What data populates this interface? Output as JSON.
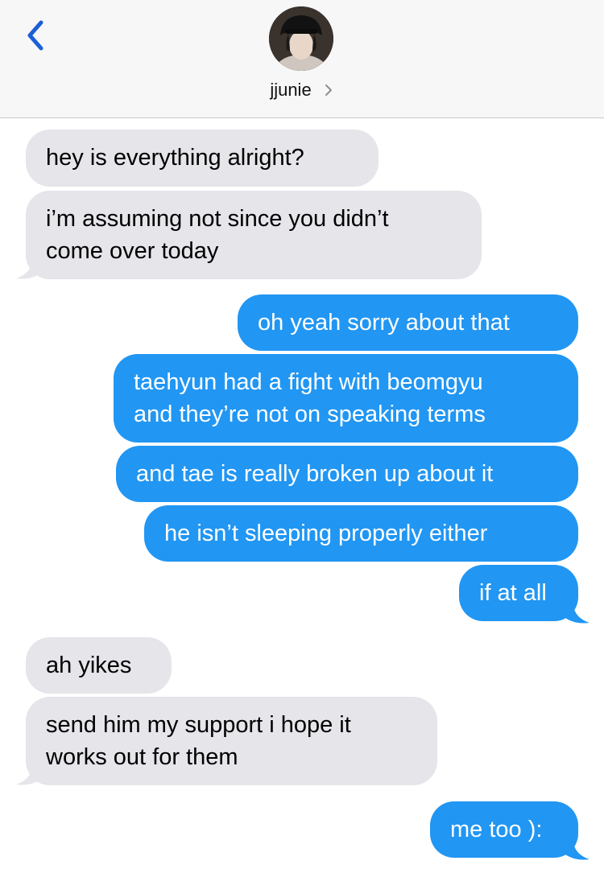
{
  "header": {
    "back_icon": "chevron-left-icon",
    "contact_name": "jjunie",
    "contact_chevron_icon": "chevron-right-icon",
    "avatar_icon": "contact-avatar"
  },
  "colors": {
    "incoming_bubble": "#e5e5ea",
    "outgoing_bubble": "#2196f3",
    "accent_blue": "#1a5fd6",
    "header_bg": "#f7f7f7"
  },
  "messages": [
    {
      "direction": "in",
      "text": "hey is everything alright?"
    },
    {
      "direction": "in",
      "lines": [
        "i’m assuming not since you didn’t",
        "come over today"
      ]
    },
    {
      "direction": "out",
      "text": "oh yeah sorry about that"
    },
    {
      "direction": "out",
      "lines": [
        "taehyun had a fight with beomgyu",
        "and they’re not on speaking terms"
      ]
    },
    {
      "direction": "out",
      "text": "and tae is really broken up about it"
    },
    {
      "direction": "out",
      "text": "he isn’t sleeping properly either"
    },
    {
      "direction": "out",
      "text": "if at all"
    },
    {
      "direction": "in",
      "text": "ah yikes"
    },
    {
      "direction": "in",
      "lines": [
        "send him my support i hope it",
        "works out for them"
      ]
    },
    {
      "direction": "out",
      "text": "me too ):"
    }
  ]
}
